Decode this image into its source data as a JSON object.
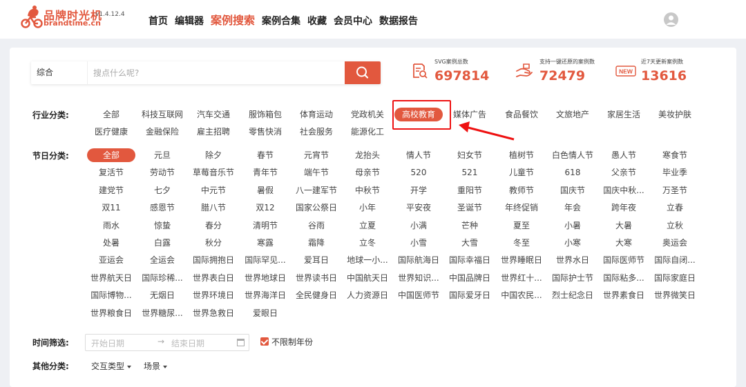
{
  "brand": {
    "title": "品牌时光机",
    "domain": "brandtime.cn",
    "version": "v1.4.12.4"
  },
  "nav": [
    "首页",
    "编辑器",
    "案例搜索",
    "案例合集",
    "收藏",
    "会员中心",
    "数据报告"
  ],
  "nav_active_index": 2,
  "search": {
    "type": "综合",
    "placeholder": "搜点什么呢?"
  },
  "stats": [
    {
      "label": "SVG案例总数",
      "value": "697814",
      "icon": "document-search-icon"
    },
    {
      "label": "支持一键还原的案例数",
      "value": "72479",
      "icon": "hand-restore-icon"
    },
    {
      "label": "近7天更新案例数",
      "value": "13616",
      "icon": "new-badge-icon",
      "badge": "NEW"
    }
  ],
  "industry": {
    "label": "行业分类:",
    "items": [
      "全部",
      "科技互联网",
      "汽车交通",
      "服饰箱包",
      "体育运动",
      "党政机关",
      "高校教育",
      "媒体广告",
      "食品餐饮",
      "文旅地产",
      "家居生活",
      "美妆护肤",
      "医疗健康",
      "金融保险",
      "雇主招聘",
      "零售快消",
      "社会服务",
      "能源化工"
    ],
    "selected": "高校教育"
  },
  "festival": {
    "label": "节日分类:",
    "selected": "全部",
    "items": [
      "全部",
      "元旦",
      "除夕",
      "春节",
      "元宵节",
      "龙抬头",
      "情人节",
      "妇女节",
      "植树节",
      "白色情人节",
      "愚人节",
      "寒食节",
      "复活节",
      "劳动节",
      "草莓音乐节",
      "青年节",
      "端午节",
      "母亲节",
      "520",
      "521",
      "儿童节",
      "618",
      "父亲节",
      "毕业季",
      "建党节",
      "七夕",
      "中元节",
      "暑假",
      "八一建军节",
      "中秋节",
      "开学",
      "重阳节",
      "教师节",
      "国庆节",
      "国庆中秋...",
      "万圣节",
      "双11",
      "感恩节",
      "腊八节",
      "双12",
      "国家公祭日",
      "小年",
      "平安夜",
      "圣诞节",
      "年终促销",
      "年会",
      "跨年夜",
      "立春",
      "雨水",
      "惊蛰",
      "春分",
      "清明节",
      "谷雨",
      "立夏",
      "小满",
      "芒种",
      "夏至",
      "小暑",
      "大暑",
      "立秋",
      "处暑",
      "白露",
      "秋分",
      "寒露",
      "霜降",
      "立冬",
      "小雪",
      "大雪",
      "冬至",
      "小寒",
      "大寒",
      "奥运会",
      "亚运会",
      "全运会",
      "国际拥抱日",
      "国际罕见...",
      "爱耳日",
      "地球一小...",
      "国际航海日",
      "国际幸福日",
      "世界睡眠日",
      "世界水日",
      "国际医师节",
      "国际自闭...",
      "世界航天日",
      "国际珍稀...",
      "世界表白日",
      "世界地球日",
      "世界读书日",
      "中国航天日",
      "世界知识...",
      "中国品牌日",
      "世界红十...",
      "国际护士节",
      "国际粘多...",
      "国际家庭日",
      "国际博物...",
      "无烟日",
      "世界环境日",
      "世界海洋日",
      "全民健身日",
      "人力资源日",
      "中国医师节",
      "国际爱牙日",
      "中国农民...",
      "烈士纪念日",
      "世界素食日",
      "世界微笑日",
      "世界粮食日",
      "世界糖尿...",
      "世界急救日",
      "爱眼日"
    ]
  },
  "time_filter": {
    "label": "时间筛选:",
    "start_placeholder": "开始日期",
    "arrow": "→",
    "end_placeholder": "结束日期",
    "checkbox_label": "不限制年份",
    "checked": true
  },
  "other": {
    "label": "其他分类:",
    "dropdowns": [
      "交互类型",
      "场景"
    ]
  },
  "colors": {
    "accent": "#e2583e",
    "highlight_box": "#e11111"
  }
}
